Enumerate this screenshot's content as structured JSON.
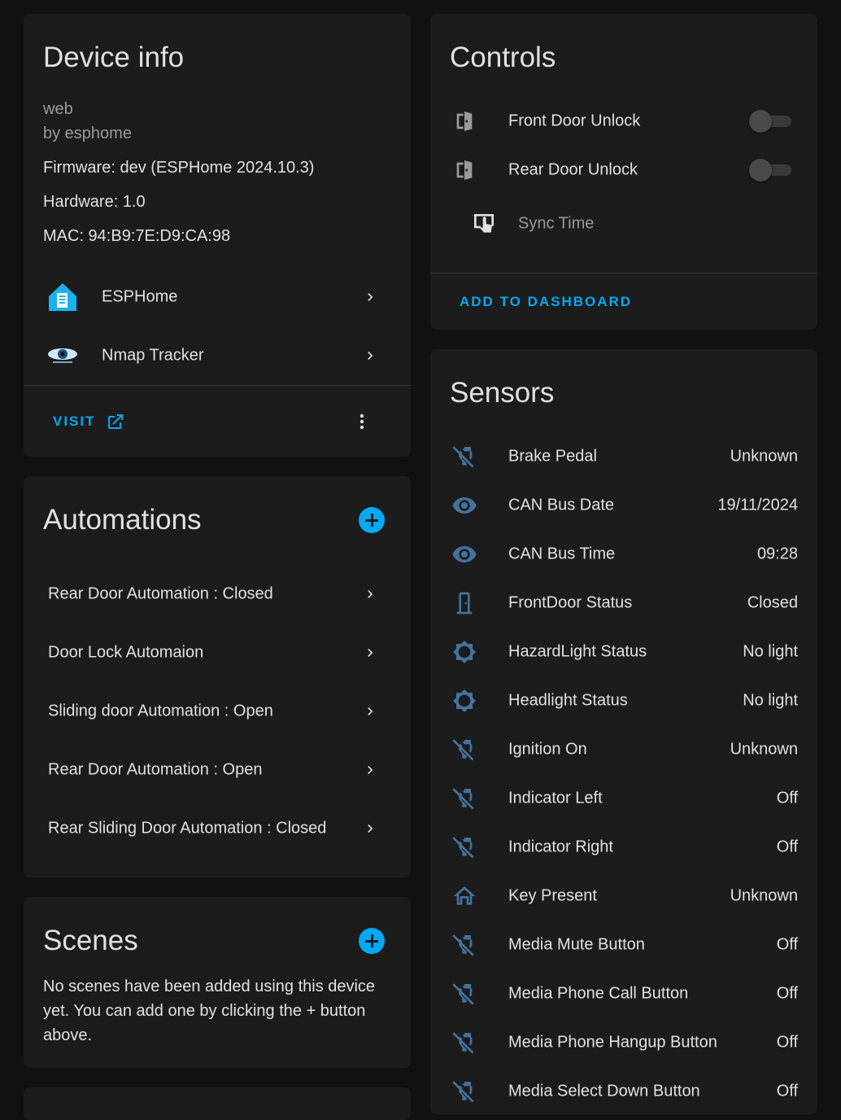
{
  "device_info": {
    "title": "Device info",
    "model": "web",
    "manufacturer": "by esphome",
    "firmware": "Firmware: dev (ESPHome 2024.10.3)",
    "hardware": "Hardware: 1.0",
    "mac": "MAC: 94:B9:7E:D9:CA:98",
    "integrations": [
      {
        "label": "ESPHome",
        "icon": "esphome-logo-icon"
      },
      {
        "label": "Nmap Tracker",
        "icon": "nmap-eye-logo-icon"
      }
    ],
    "visit_label": "VISIT"
  },
  "automations": {
    "title": "Automations",
    "items": [
      "Rear Door Automation : Closed",
      "Door Lock Automaion",
      "Sliding door Automation : Open",
      "Rear Door Automation : Open",
      "Rear Sliding Door Automation : Closed"
    ]
  },
  "scenes": {
    "title": "Scenes",
    "empty_text": "No scenes have been added using this device yet. You can add one by clicking the + button above."
  },
  "controls": {
    "title": "Controls",
    "switches": [
      {
        "label": "Front Door Unlock",
        "icon": "door-open-icon",
        "state": "off"
      },
      {
        "label": "Rear Door Unlock",
        "icon": "door-open-icon",
        "state": "off"
      }
    ],
    "button": {
      "label": "Sync Time",
      "icon": "gesture-tap-button-icon"
    },
    "add_to_dashboard": "ADD TO DASHBOARD"
  },
  "sensors": {
    "title": "Sensors",
    "items": [
      {
        "label": "Brake Pedal",
        "value": "Unknown",
        "icon": "power-plug-off-icon"
      },
      {
        "label": "CAN Bus Date",
        "value": "19/11/2024",
        "icon": "eye-icon"
      },
      {
        "label": "CAN Bus Time",
        "value": "09:28",
        "icon": "eye-icon"
      },
      {
        "label": "FrontDoor Status",
        "value": "Closed",
        "icon": "door-closed-icon"
      },
      {
        "label": "HazardLight Status",
        "value": "No light",
        "icon": "brightness-icon"
      },
      {
        "label": "Headlight Status",
        "value": "No light",
        "icon": "brightness-icon"
      },
      {
        "label": "Ignition On",
        "value": "Unknown",
        "icon": "power-plug-off-icon"
      },
      {
        "label": "Indicator Left",
        "value": "Off",
        "icon": "power-plug-off-icon"
      },
      {
        "label": "Indicator Right",
        "value": "Off",
        "icon": "power-plug-off-icon"
      },
      {
        "label": "Key Present",
        "value": "Unknown",
        "icon": "home-outline-icon"
      },
      {
        "label": "Media Mute Button",
        "value": "Off",
        "icon": "power-plug-off-icon"
      },
      {
        "label": "Media Phone Call Button",
        "value": "Off",
        "icon": "power-plug-off-icon"
      },
      {
        "label": "Media Phone Hangup Button",
        "value": "Off",
        "icon": "power-plug-off-icon"
      },
      {
        "label": "Media Select Down Button",
        "value": "Off",
        "icon": "power-plug-off-icon"
      }
    ]
  },
  "colors": {
    "background": "#111111",
    "card": "#1c1c1c",
    "accent": "#03a9f4",
    "icon_blue": "#44739e",
    "text": "#e1e1e1",
    "secondary_text": "#9b9b9b"
  }
}
